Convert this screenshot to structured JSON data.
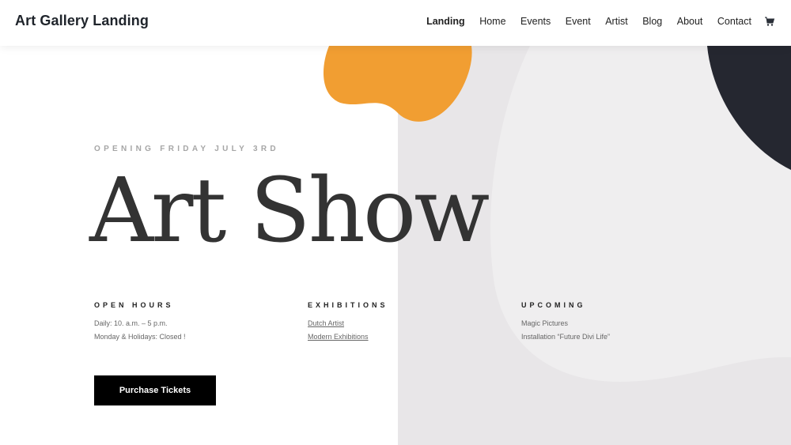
{
  "header": {
    "logo": "Art Gallery Landing",
    "nav": [
      {
        "label": "Landing",
        "active": true
      },
      {
        "label": "Home"
      },
      {
        "label": "Events"
      },
      {
        "label": "Event"
      },
      {
        "label": "Artist"
      },
      {
        "label": "Blog"
      },
      {
        "label": "About"
      },
      {
        "label": "Contact"
      }
    ],
    "cart_icon": "shopping-cart-icon"
  },
  "hero": {
    "eyebrow": "OPENING FRIDAY JULY 3RD",
    "title": "Art Show",
    "columns": [
      {
        "heading": "OPEN HOURS",
        "lines": [
          "Daily: 10. a.m. – 5 p.m.",
          "Monday & Holidays: Closed !"
        ]
      },
      {
        "heading": "EXHIBITIONS",
        "links": [
          "Dutch Artist",
          "Modern Exhibitions"
        ]
      },
      {
        "heading": "UPCOMING",
        "lines": [
          "Magic Pictures",
          "Installation “Future Divi Life”"
        ]
      }
    ],
    "cta": "Purchase Tickets"
  },
  "colors": {
    "accent_orange": "#f19e32",
    "dark_shape": "#252730",
    "panel_gray": "#e8e6e8"
  }
}
